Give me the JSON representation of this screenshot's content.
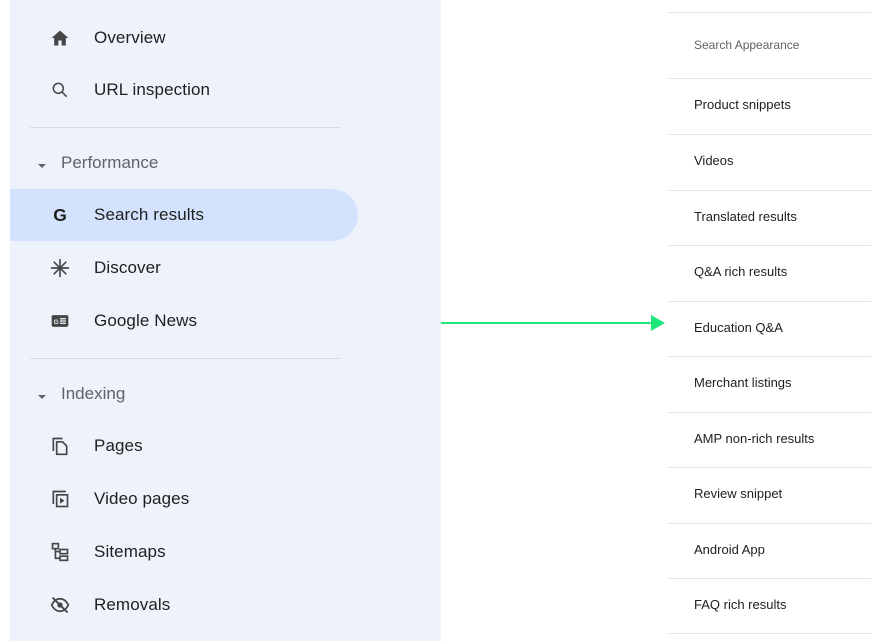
{
  "sidebar": {
    "items": [
      {
        "label": "Overview",
        "icon": "home-icon"
      },
      {
        "label": "URL inspection",
        "icon": "search-icon"
      }
    ],
    "performance": {
      "header": "Performance",
      "items": [
        {
          "label": "Search results",
          "icon": "google-g-icon",
          "active": true
        },
        {
          "label": "Discover",
          "icon": "asterisk-icon"
        },
        {
          "label": "Google News",
          "icon": "google-news-icon"
        }
      ]
    },
    "indexing": {
      "header": "Indexing",
      "items": [
        {
          "label": "Pages",
          "icon": "pages-icon"
        },
        {
          "label": "Video pages",
          "icon": "video-pages-icon"
        },
        {
          "label": "Sitemaps",
          "icon": "sitemap-icon"
        },
        {
          "label": "Removals",
          "icon": "removals-icon"
        }
      ]
    }
  },
  "search_appearance": {
    "header": "Search Appearance",
    "items": [
      "Product snippets",
      "Videos",
      "Translated results",
      "Q&A rich results",
      "Education Q&A",
      "Merchant listings",
      "AMP non-rich results",
      "Review snippet",
      "Android App",
      "FAQ rich results"
    ]
  },
  "colors": {
    "sidebar_bg": "#eef2fa",
    "active_bg": "#d3e3fd",
    "arrow": "#1ee87a",
    "text": "#1f1f1f",
    "muted": "#5f6368"
  }
}
